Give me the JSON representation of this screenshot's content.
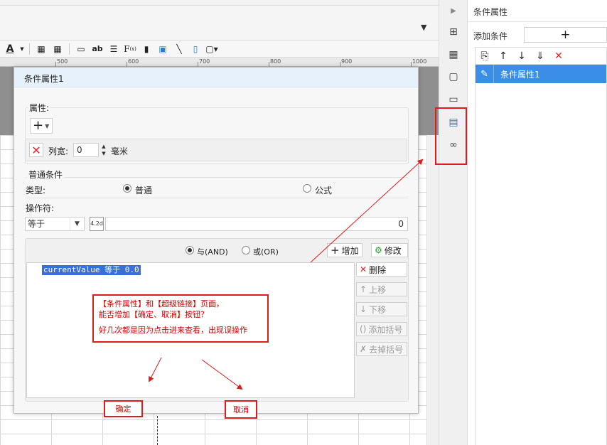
{
  "panel": {
    "title": "条件属性",
    "add_condition_label": "添加条件",
    "add_button_symbol": "+",
    "list": [
      {
        "label": "条件属性1",
        "selected": true
      }
    ]
  },
  "ruler": {
    "ticks": [
      "500",
      "600",
      "700",
      "800",
      "900",
      "1000"
    ]
  },
  "dialog": {
    "title": "条件属性1",
    "attr_section_label": "属性:",
    "add_attr_symbol": "+",
    "column_width_label": "列宽:",
    "column_width_value": "0",
    "unit_label": "毫米",
    "common_condition_label": "普通条件",
    "type_label": "类型:",
    "type_options": [
      {
        "label": "普通",
        "selected": true
      },
      {
        "label": "公式",
        "selected": false
      }
    ],
    "operator_label": "操作符:",
    "operator_value": "等于",
    "value_input": "0",
    "logic_options": [
      {
        "label": "与(AND)",
        "selected": true
      },
      {
        "label": "或(OR)",
        "selected": false
      }
    ],
    "buttons": {
      "add": "增加",
      "modify": "修改",
      "delete": "删除",
      "move_up": "上移",
      "move_down": "下移",
      "add_bracket": "添加括号",
      "remove_bracket": "去掉括号"
    },
    "condition_item": "currentValue 等于 0.0"
  },
  "annotation": {
    "line1": "【条件属性】和【超级链接】页面，",
    "line2": "能否增加【确定、取消】按钮？",
    "line3": "好几次都是因为点击进来查看，出现误操作",
    "ok_label": "确定",
    "cancel_label": "取消"
  },
  "colors": {
    "annotation_red": "#e01b1b",
    "selection_blue": "#3a8ee6",
    "dialog_title_bg": "#e6f1fb"
  }
}
